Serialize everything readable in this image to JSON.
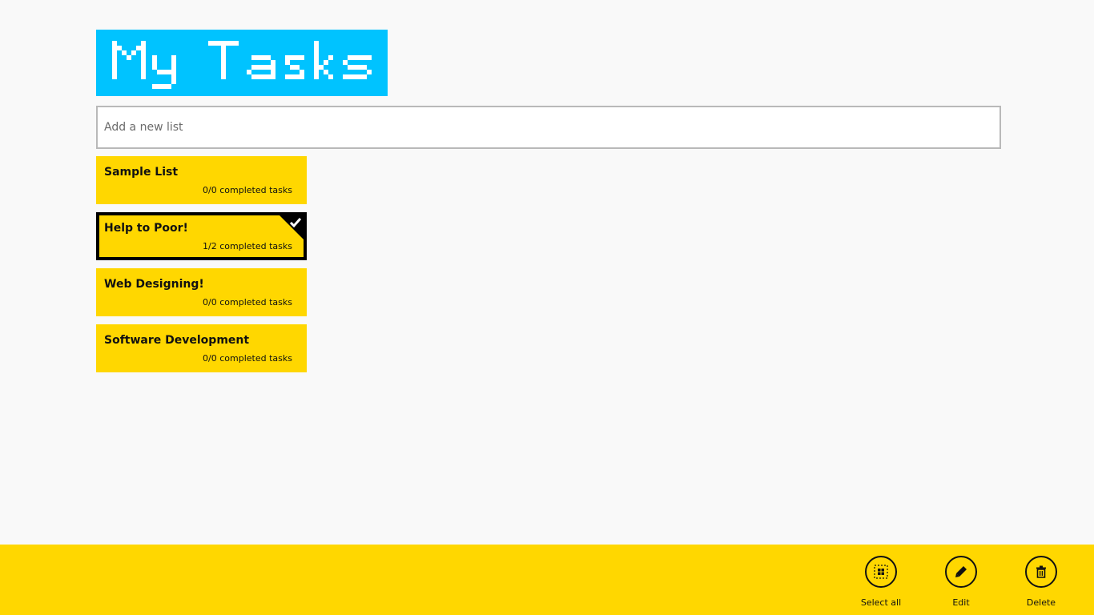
{
  "app": {
    "title": "My Tasks",
    "accent_color": "#00c3ff",
    "tile_color": "#ffd700"
  },
  "new_list": {
    "placeholder": "Add a new list",
    "value": ""
  },
  "lists": [
    {
      "name": "Sample List",
      "count": "0/0 completed tasks",
      "selected": false
    },
    {
      "name": "Help to Poor!",
      "count": "1/2 completed tasks",
      "selected": true
    },
    {
      "name": "Web Designing!",
      "count": "0/0 completed tasks",
      "selected": false
    },
    {
      "name": "Software Development",
      "count": "0/0 completed tasks",
      "selected": false
    }
  ],
  "app_bar": {
    "select_all": {
      "label": "Select all",
      "icon": "select-all-icon"
    },
    "edit": {
      "label": "Edit",
      "icon": "pencil-icon"
    },
    "delete": {
      "label": "Delete",
      "icon": "trash-icon"
    }
  }
}
